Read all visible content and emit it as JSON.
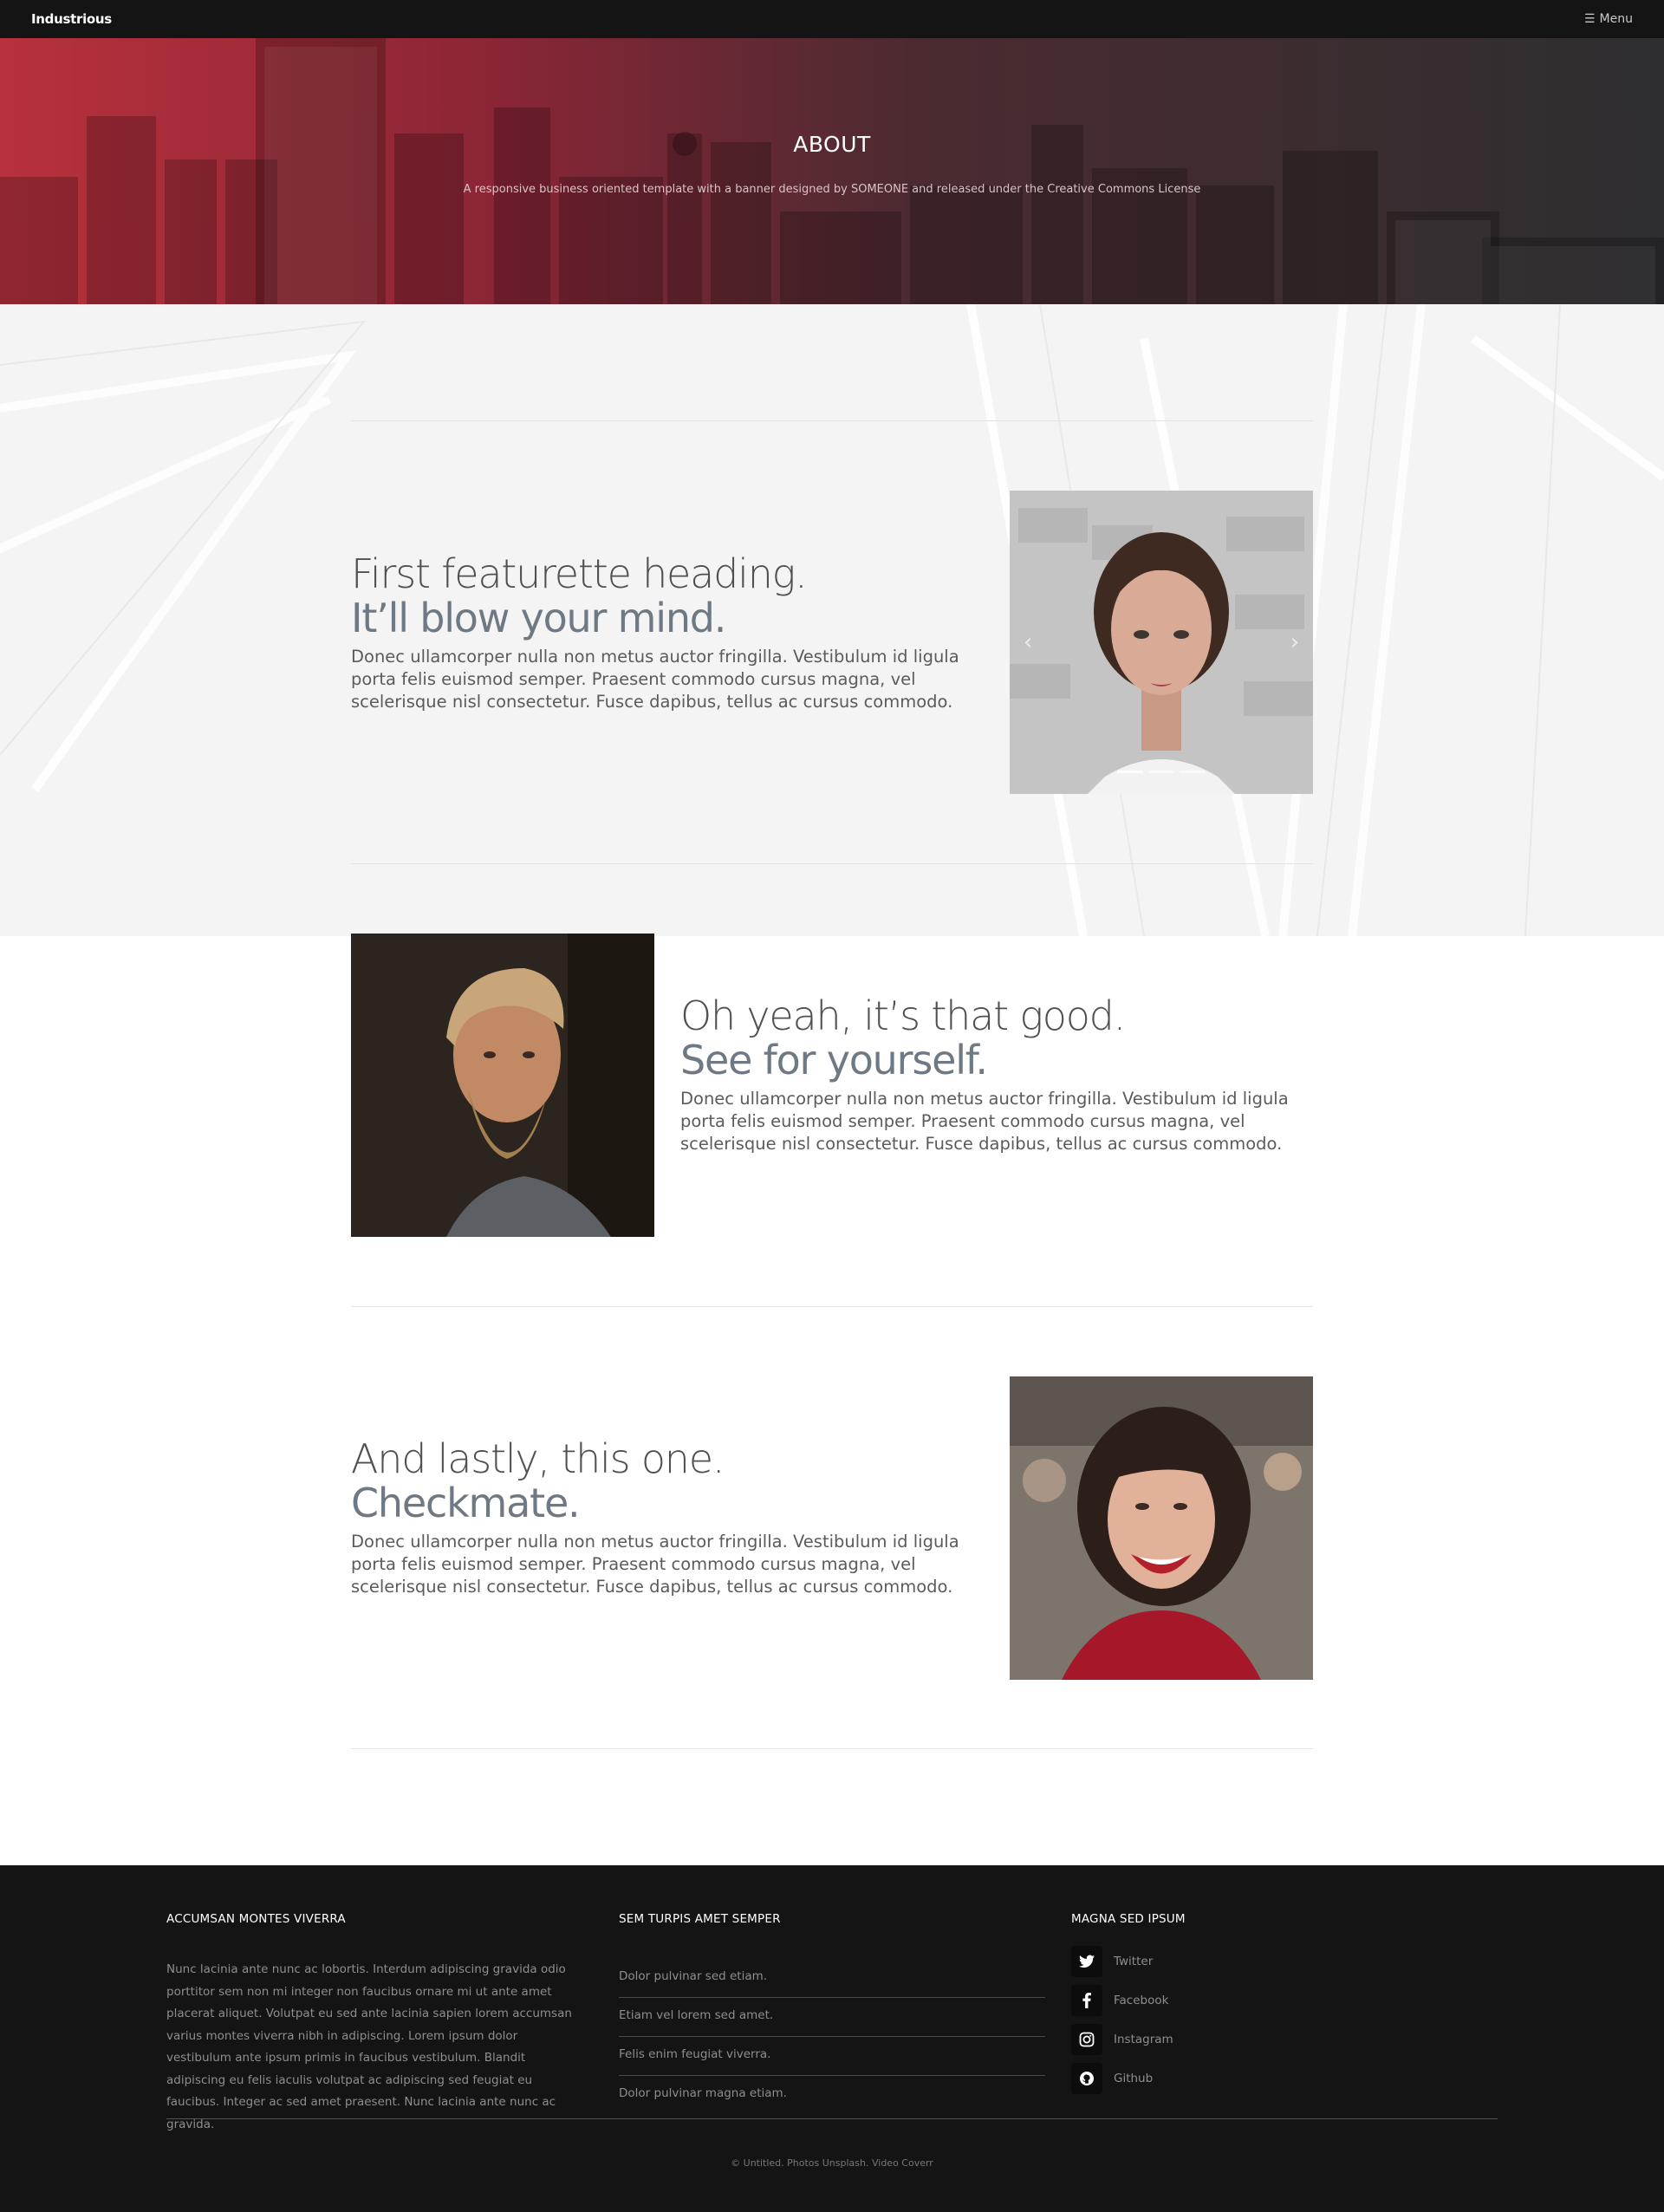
{
  "nav": {
    "brand": "Industrious",
    "menu_label": "Menu",
    "menu_icon": "hamburger-icon"
  },
  "banner": {
    "title": "ABOUT",
    "subtitle": "A responsive business oriented template with a banner designed by SOMEONE and released under the Creative Commons License"
  },
  "featurettes": [
    {
      "heading": "First featurette heading.",
      "muted": "It’ll blow your mind.",
      "body": "Donec ullamcorper nulla non metus auctor fringilla. Vestibulum id ligula porta felis euismod semper. Praesent commodo cursus magna, vel scelerisque nisl consectetur. Fusce dapibus, tellus ac cursus commodo."
    },
    {
      "heading": "Oh yeah, it’s that good.",
      "muted": "See for yourself.",
      "body": "Donec ullamcorper nulla non metus auctor fringilla. Vestibulum id ligula porta felis euismod semper. Praesent commodo cursus magna, vel scelerisque nisl consectetur. Fusce dapibus, tellus ac cursus commodo."
    },
    {
      "heading": "And lastly, this one.",
      "muted": "Checkmate.",
      "body": "Donec ullamcorper nulla non metus auctor fringilla. Vestibulum id ligula porta felis euismod semper. Praesent commodo cursus magna, vel scelerisque nisl consectetur. Fusce dapibus, tellus ac cursus commodo."
    }
  ],
  "carousel": {
    "prev_icon": "chevron-left-icon",
    "next_icon": "chevron-right-icon",
    "slide_count": 3,
    "active_index": 0
  },
  "footer": {
    "col1": {
      "heading": "ACCUMSAN MONTES VIVERRA",
      "text": "Nunc lacinia ante nunc ac lobortis. Interdum adipiscing gravida odio porttitor sem non mi integer non faucibus ornare mi ut ante amet placerat aliquet. Volutpat eu sed ante lacinia sapien lorem accumsan varius montes viverra nibh in adipiscing. Lorem ipsum dolor vestibulum ante ipsum primis in faucibus vestibulum. Blandit adipiscing eu felis iaculis volutpat ac adipiscing sed feugiat eu faucibus. Integer ac sed amet praesent. Nunc lacinia ante nunc ac gravida."
    },
    "col2": {
      "heading": "SEM TURPIS AMET SEMPER",
      "links": [
        "Dolor pulvinar sed etiam.",
        "Etiam vel lorem sed amet.",
        "Felis enim feugiat viverra.",
        "Dolor pulvinar magna etiam."
      ]
    },
    "col3": {
      "heading": "MAGNA SED IPSUM",
      "social": [
        {
          "label": "Twitter",
          "icon": "twitter-icon"
        },
        {
          "label": "Facebook",
          "icon": "facebook-icon"
        },
        {
          "label": "Instagram",
          "icon": "instagram-icon"
        },
        {
          "label": "Github",
          "icon": "github-icon"
        }
      ]
    },
    "copyright": "© Untitled. Photos Unsplash. Video Coverr"
  },
  "colors": {
    "banner_red": "#b8313c",
    "banner_dark": "#2e2e30",
    "footer_bg": "#141414",
    "text_muted": "#6f7983"
  }
}
